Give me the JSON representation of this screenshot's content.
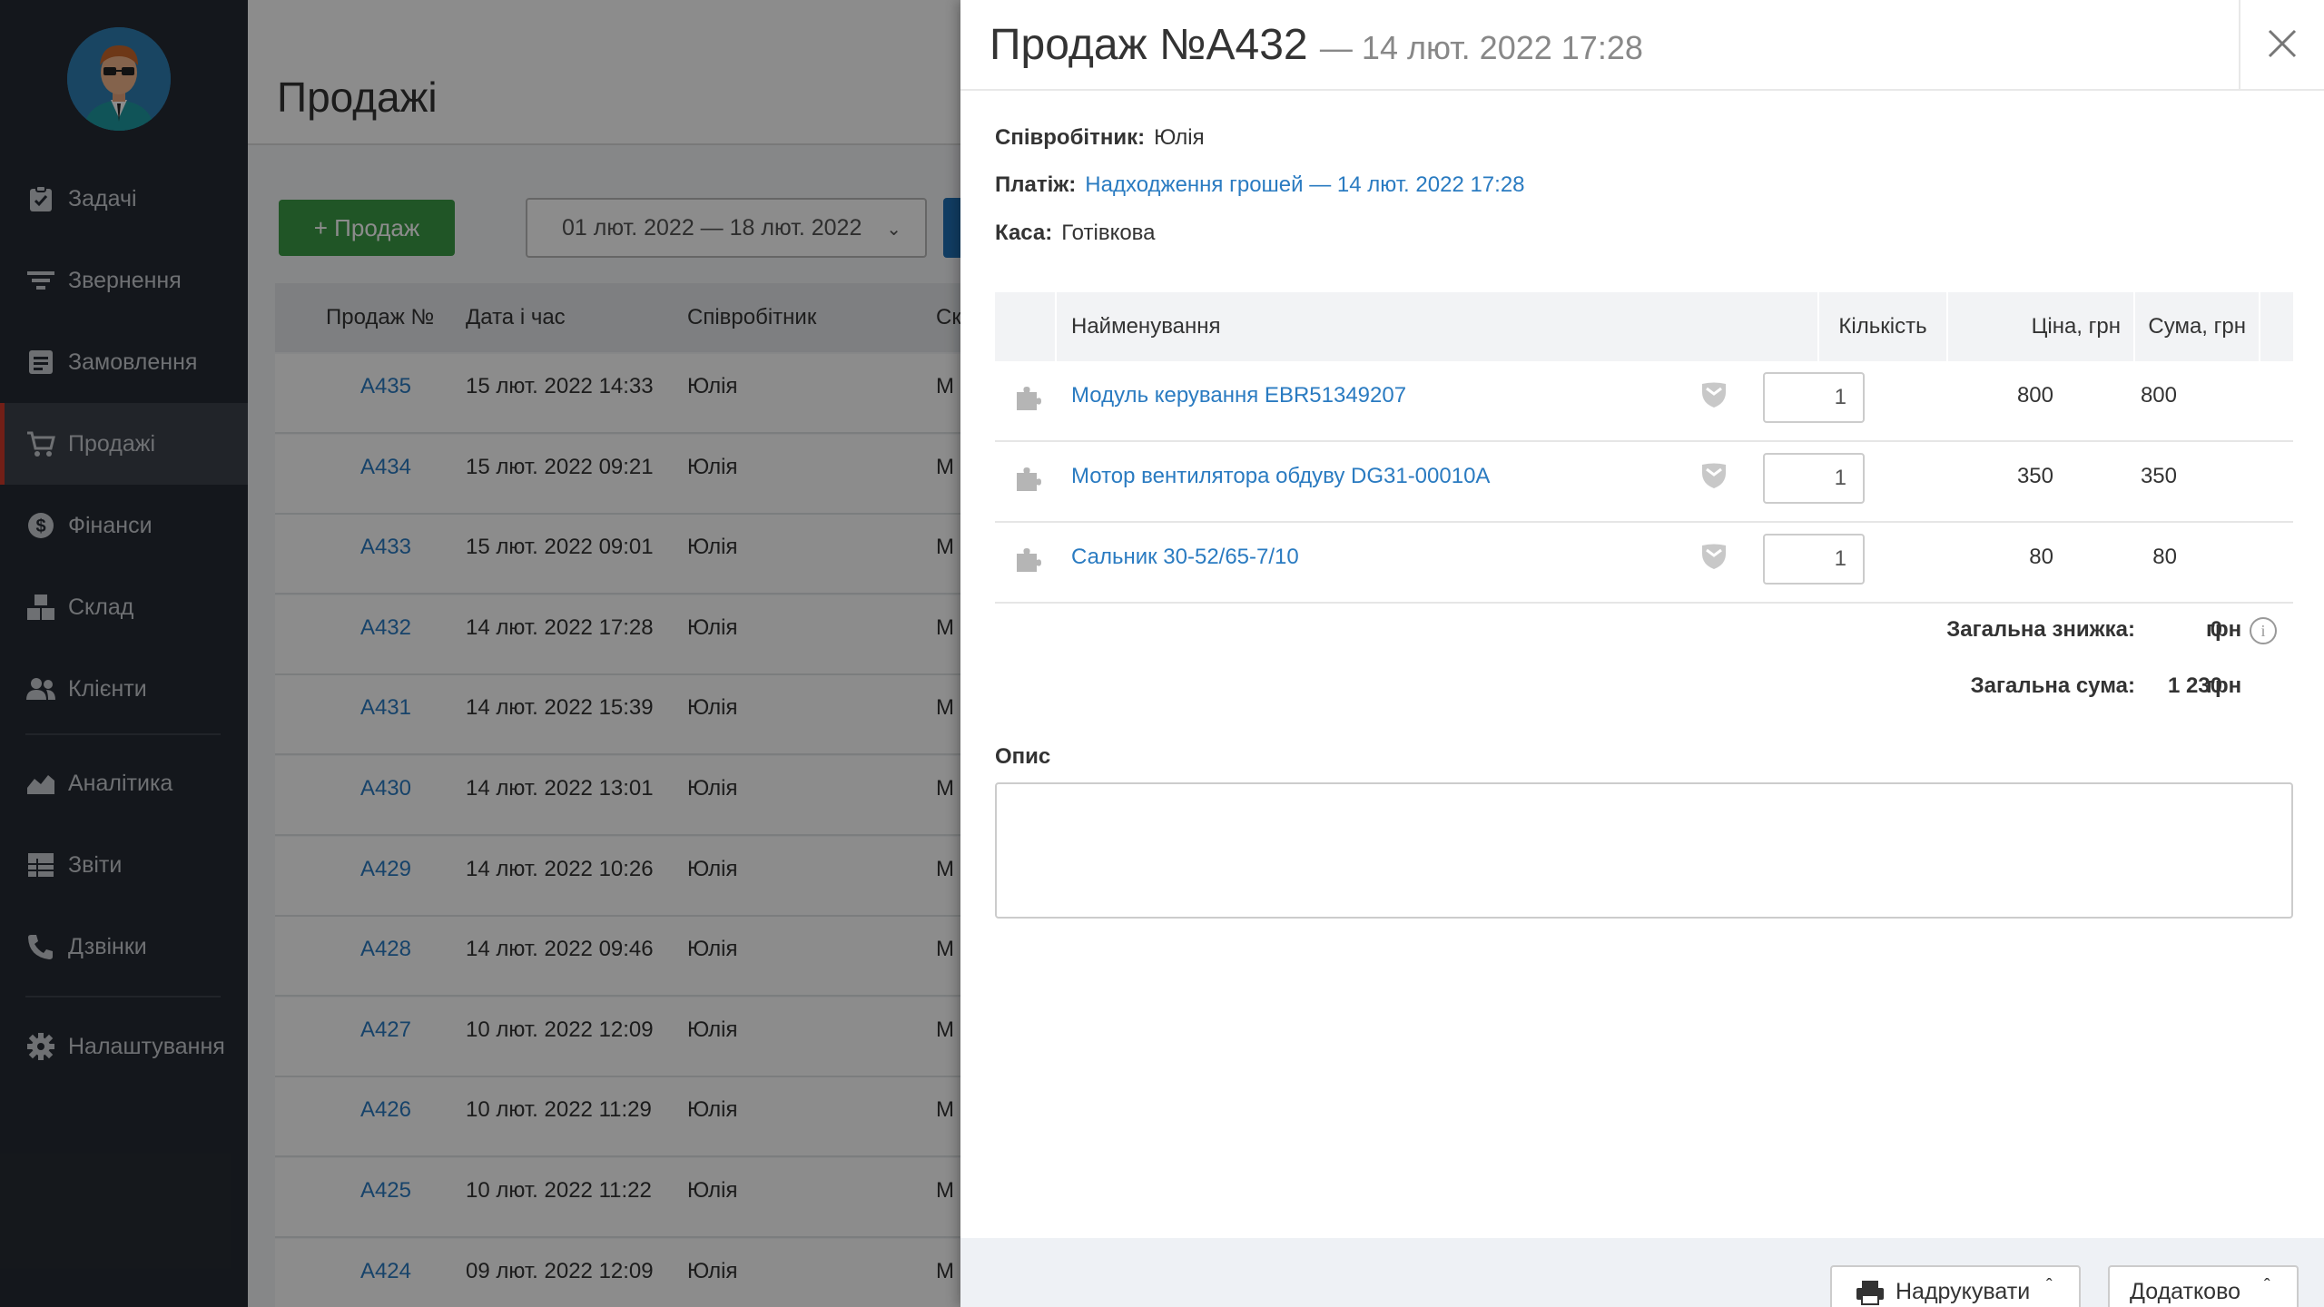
{
  "sidebar": {
    "items": [
      {
        "label": "Задачі",
        "icon": "clipboard-check-icon"
      },
      {
        "label": "Звернення",
        "icon": "filter-icon"
      },
      {
        "label": "Замовлення",
        "icon": "order-list-icon"
      },
      {
        "label": "Продажі",
        "icon": "cart-icon"
      },
      {
        "label": "Фінанси",
        "icon": "dollar-circle-icon"
      },
      {
        "label": "Склад",
        "icon": "boxes-icon"
      },
      {
        "label": "Клієнти",
        "icon": "users-icon"
      },
      {
        "label": "Аналітика",
        "icon": "chart-area-icon"
      },
      {
        "label": "Звіти",
        "icon": "table-icon"
      },
      {
        "label": "Дзвінки",
        "icon": "phone-icon"
      },
      {
        "label": "Налаштування",
        "icon": "gear-icon"
      }
    ],
    "active": "Продажі"
  },
  "main": {
    "title": "Продажі",
    "add_button": "+ Продаж",
    "date_range": "01 лют. 2022 — 18 лют. 2022",
    "columns": [
      "Продаж №",
      "Дата і час",
      "Співробітник",
      "Ск"
    ],
    "rows": [
      {
        "num": "А435",
        "date": "15 лют. 2022 14:33",
        "employee": "Юлія",
        "extra": "М"
      },
      {
        "num": "А434",
        "date": "15 лют. 2022 09:21",
        "employee": "Юлія",
        "extra": "М"
      },
      {
        "num": "А433",
        "date": "15 лют. 2022 09:01",
        "employee": "Юлія",
        "extra": "М"
      },
      {
        "num": "А432",
        "date": "14 лют. 2022 17:28",
        "employee": "Юлія",
        "extra": "М"
      },
      {
        "num": "А431",
        "date": "14 лют. 2022 15:39",
        "employee": "Юлія",
        "extra": "М"
      },
      {
        "num": "А430",
        "date": "14 лют. 2022 13:01",
        "employee": "Юлія",
        "extra": "М"
      },
      {
        "num": "А429",
        "date": "14 лют. 2022 10:26",
        "employee": "Юлія",
        "extra": "М"
      },
      {
        "num": "А428",
        "date": "14 лют. 2022 09:46",
        "employee": "Юлія",
        "extra": "М"
      },
      {
        "num": "А427",
        "date": "10 лют. 2022 12:09",
        "employee": "Юлія",
        "extra": "М"
      },
      {
        "num": "А426",
        "date": "10 лют. 2022 11:29",
        "employee": "Юлія",
        "extra": "М"
      },
      {
        "num": "А425",
        "date": "10 лют. 2022 11:22",
        "employee": "Юлія",
        "extra": "М"
      },
      {
        "num": "А424",
        "date": "09 лют. 2022 12:09",
        "employee": "Юлія",
        "extra": "М"
      }
    ]
  },
  "modal": {
    "title": "Продаж №А432",
    "subtitle": "— 14 лют. 2022 17:28",
    "employee_label": "Співробітник:",
    "employee_value": "Юлія",
    "payment_label": "Платіж:",
    "payment_value": "Надходження грошей — 14 лют. 2022 17:28",
    "cash_label": "Каса:",
    "cash_value": "Готівкова",
    "columns": {
      "name": "Найменування",
      "qty": "Кількість",
      "price": "Ціна, грн",
      "sum": "Сума, грн"
    },
    "items": [
      {
        "name": "Модуль керування EBR51349207",
        "qty": "1",
        "price": "800",
        "sum": "800"
      },
      {
        "name": "Мотор вентилятора обдуву DG31-00010A",
        "qty": "1",
        "price": "350",
        "sum": "350"
      },
      {
        "name": "Сальник 30-52/65-7/10",
        "qty": "1",
        "price": "80",
        "sum": "80"
      }
    ],
    "discount_label": "Загальна знижка:",
    "discount_value": "0",
    "total_label": "Загальна сума:",
    "total_value": "1 230",
    "currency": "грн",
    "description_label": "Опис",
    "description_value": "",
    "print_button": "Надрукувати",
    "more_button": "Додатково"
  },
  "colors": {
    "sidebar": "#262b33",
    "accent_green": "#3b9b45",
    "link": "#2a7bc1",
    "active_marker": "#d0392b"
  }
}
